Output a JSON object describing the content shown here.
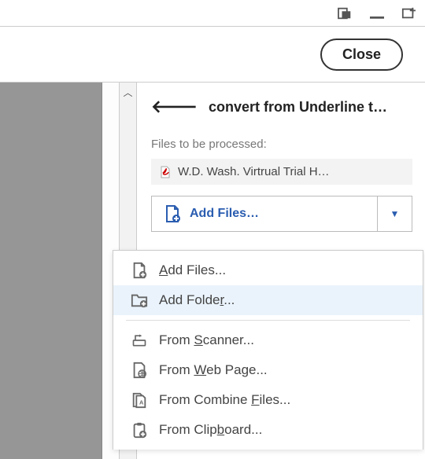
{
  "toolbar": {
    "close_label": "Close"
  },
  "panel": {
    "title": "convert from Underline t…",
    "section_label": "Files to be processed:",
    "file_item": "W.D. Wash. Virtrual Trial H…",
    "add_files_label": "Add Files…"
  },
  "menu": {
    "add_files": "Add Files...",
    "add_folder": "Add Folder...",
    "from_scanner": "From Scanner...",
    "from_web": "From Web Page...",
    "from_combine": "From Combine Files...",
    "from_clipboard": "From Clipboard..."
  }
}
